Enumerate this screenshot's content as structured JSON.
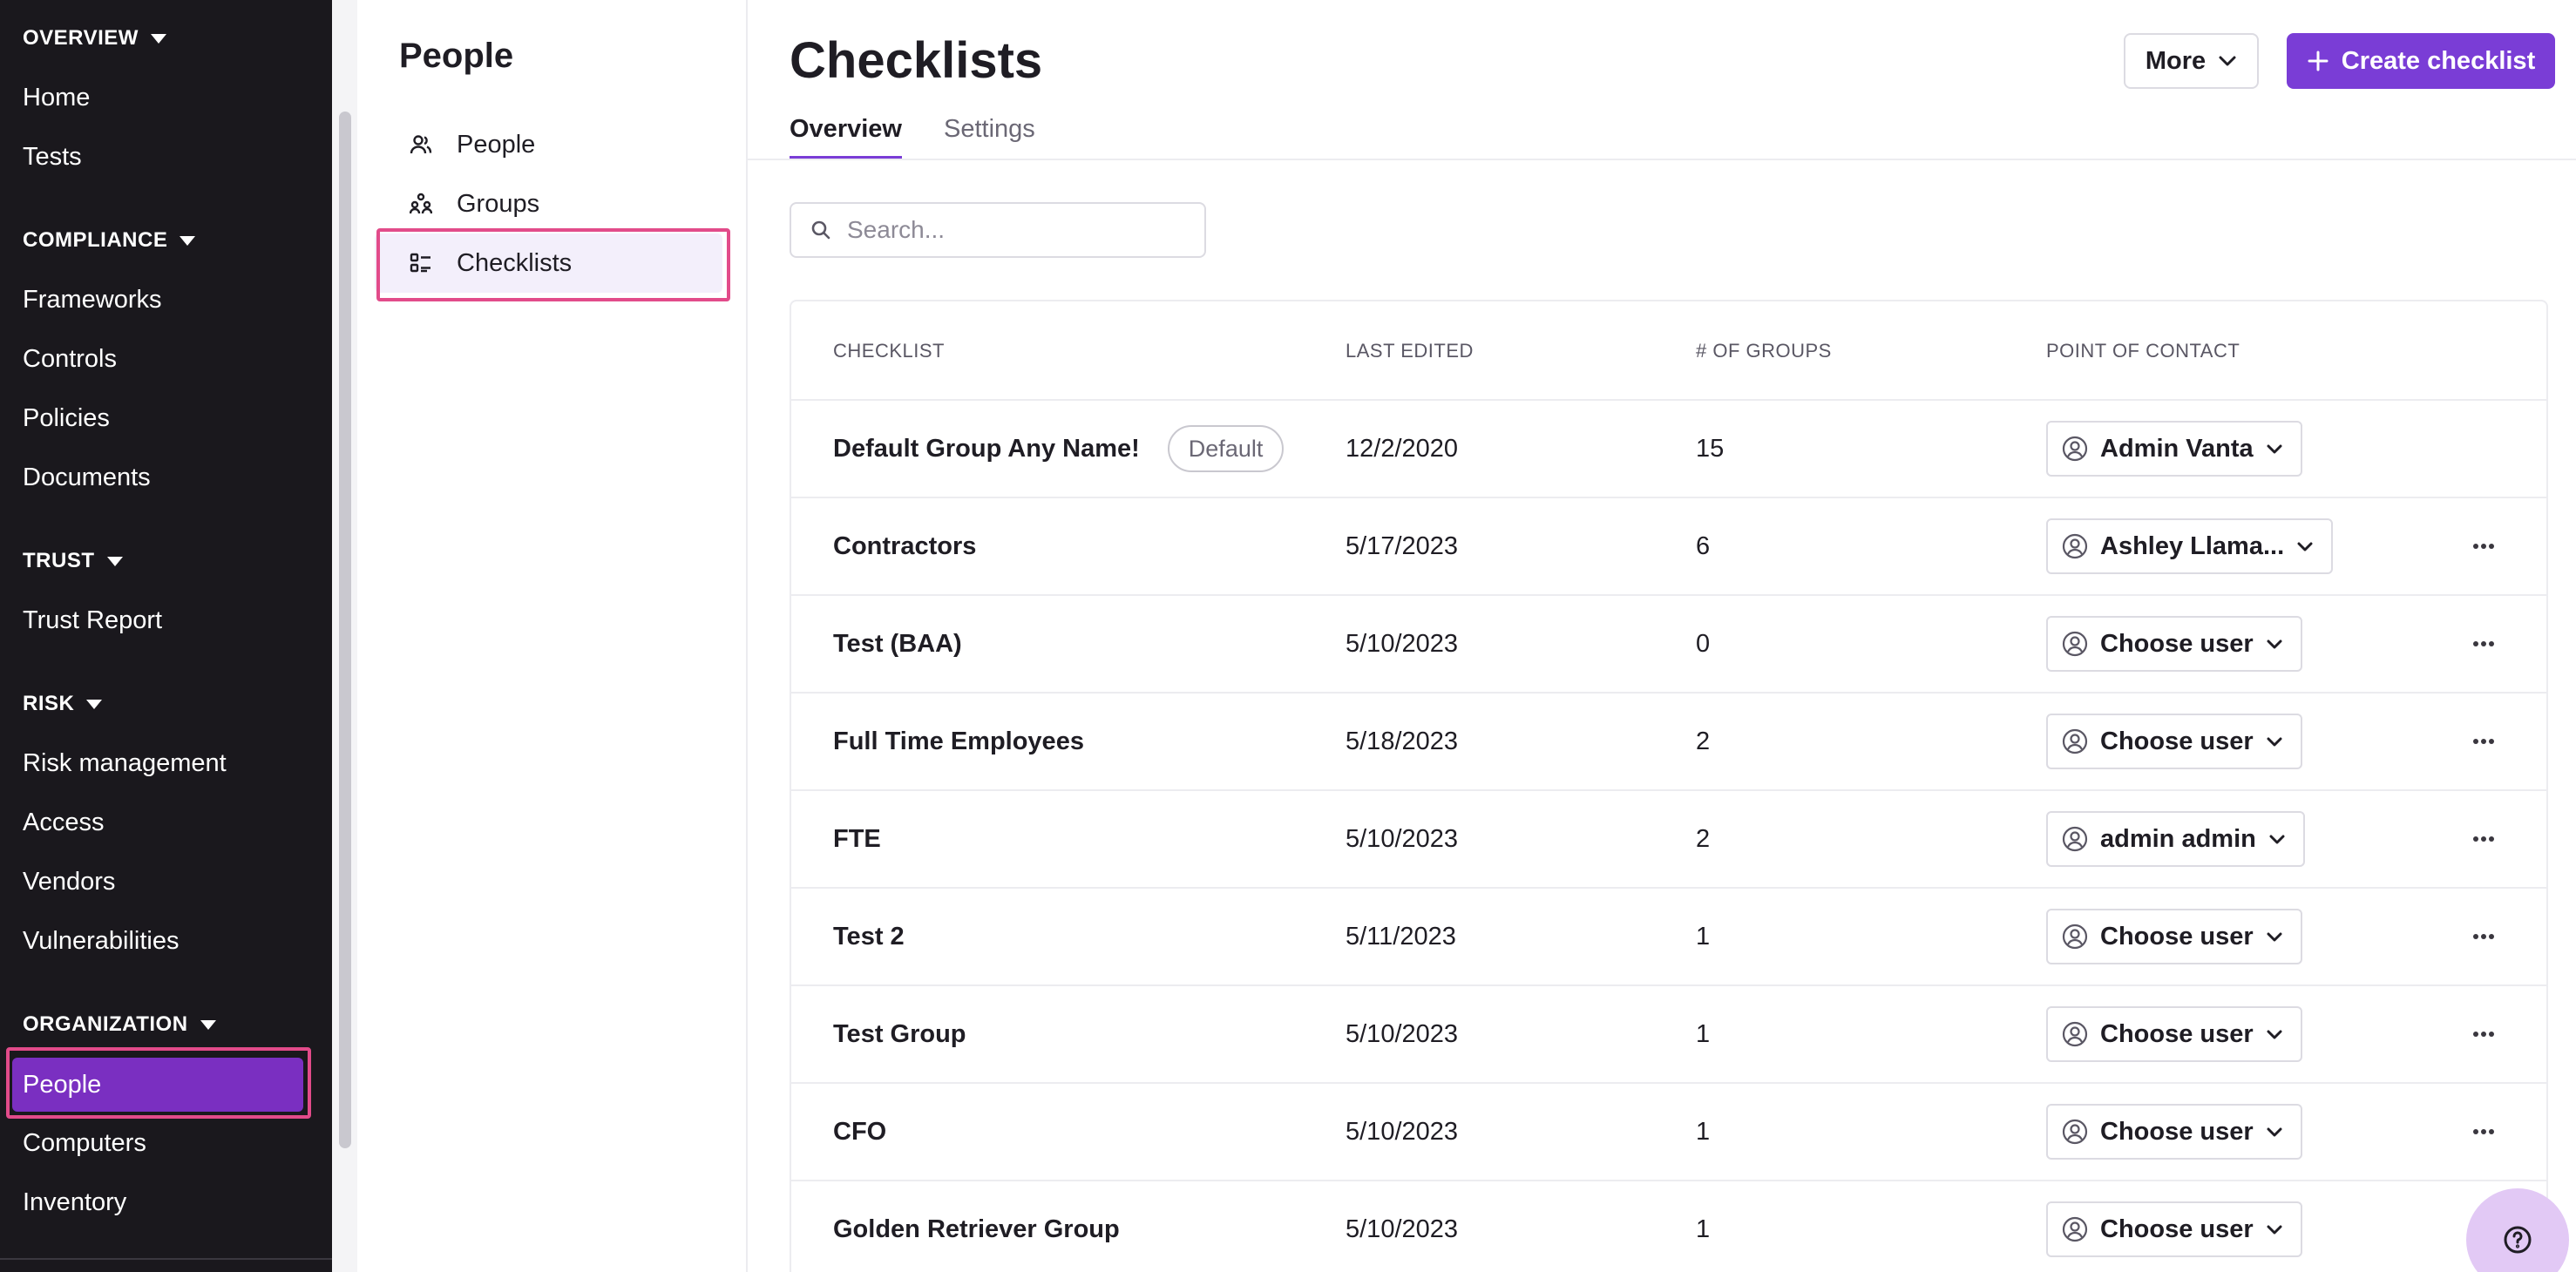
{
  "sidebar": {
    "sections": [
      {
        "title": "OVERVIEW",
        "items": [
          "Home",
          "Tests"
        ]
      },
      {
        "title": "COMPLIANCE",
        "items": [
          "Frameworks",
          "Controls",
          "Policies",
          "Documents"
        ]
      },
      {
        "title": "TRUST",
        "items": [
          "Trust Report"
        ]
      },
      {
        "title": "RISK",
        "items": [
          "Risk management",
          "Access",
          "Vendors",
          "Vulnerabilities"
        ]
      },
      {
        "title": "ORGANIZATION",
        "items": [
          "People",
          "Computers",
          "Inventory"
        ]
      }
    ],
    "active_item": "People"
  },
  "subnav": {
    "title": "People",
    "items": [
      {
        "label": "People",
        "icon": "people-icon"
      },
      {
        "label": "Groups",
        "icon": "groups-icon"
      },
      {
        "label": "Checklists",
        "icon": "checklist-icon"
      }
    ],
    "active_item": "Checklists"
  },
  "main": {
    "title": "Checklists",
    "more_label": "More",
    "create_label": "Create checklist",
    "tabs": [
      {
        "label": "Overview",
        "active": true
      },
      {
        "label": "Settings",
        "active": false
      }
    ],
    "search_placeholder": "Search..."
  },
  "table": {
    "headers": [
      "CHECKLIST",
      "LAST EDITED",
      "# OF GROUPS",
      "POINT OF CONTACT"
    ],
    "rows": [
      {
        "name": "Default Group Any Name!",
        "badge": "Default",
        "last_edited": "12/2/2020",
        "groups": "15",
        "contact": "Admin Vanta",
        "has_menu": false
      },
      {
        "name": "Contractors",
        "badge": "",
        "last_edited": "5/17/2023",
        "groups": "6",
        "contact": "Ashley Llama...",
        "has_menu": true
      },
      {
        "name": "Test (BAA)",
        "badge": "",
        "last_edited": "5/10/2023",
        "groups": "0",
        "contact": "Choose user",
        "has_menu": true
      },
      {
        "name": "Full Time Employees",
        "badge": "",
        "last_edited": "5/18/2023",
        "groups": "2",
        "contact": "Choose user",
        "has_menu": true
      },
      {
        "name": "FTE",
        "badge": "",
        "last_edited": "5/10/2023",
        "groups": "2",
        "contact": "admin admin",
        "has_menu": true
      },
      {
        "name": "Test 2",
        "badge": "",
        "last_edited": "5/11/2023",
        "groups": "1",
        "contact": "Choose user",
        "has_menu": true
      },
      {
        "name": "Test Group",
        "badge": "",
        "last_edited": "5/10/2023",
        "groups": "1",
        "contact": "Choose user",
        "has_menu": true
      },
      {
        "name": "CFO",
        "badge": "",
        "last_edited": "5/10/2023",
        "groups": "1",
        "contact": "Choose user",
        "has_menu": true
      },
      {
        "name": "Golden Retriever Group",
        "badge": "",
        "last_edited": "5/10/2023",
        "groups": "1",
        "contact": "Choose user",
        "has_menu": false
      }
    ]
  },
  "colors": {
    "sidebar_bg": "#1a181d",
    "accent": "#7a3dd6",
    "active_nav": "#7a2fc1",
    "highlight": "#e24b8a"
  }
}
